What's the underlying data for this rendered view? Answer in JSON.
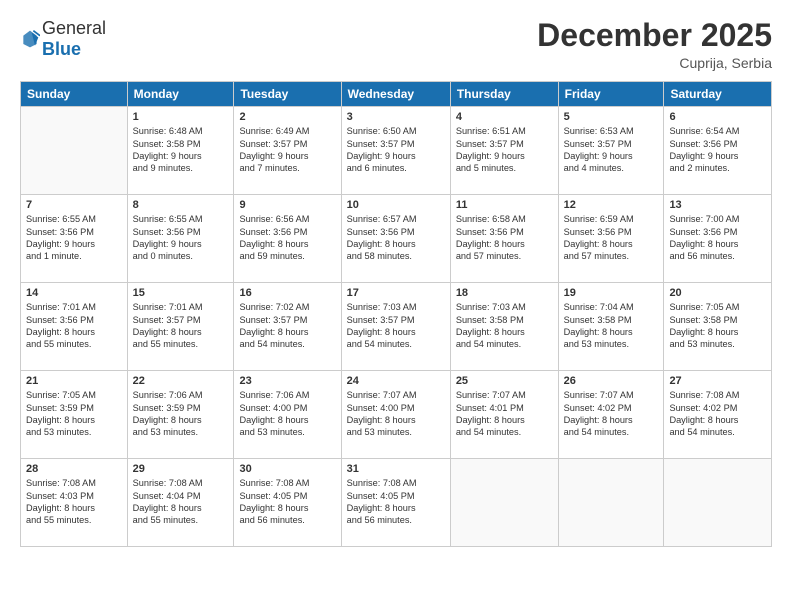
{
  "header": {
    "logo_general": "General",
    "logo_blue": "Blue",
    "month_year": "December 2025",
    "location": "Cuprija, Serbia"
  },
  "days_of_week": [
    "Sunday",
    "Monday",
    "Tuesday",
    "Wednesday",
    "Thursday",
    "Friday",
    "Saturday"
  ],
  "weeks": [
    [
      {
        "day": "",
        "info": ""
      },
      {
        "day": "1",
        "info": "Sunrise: 6:48 AM\nSunset: 3:58 PM\nDaylight: 9 hours\nand 9 minutes."
      },
      {
        "day": "2",
        "info": "Sunrise: 6:49 AM\nSunset: 3:57 PM\nDaylight: 9 hours\nand 7 minutes."
      },
      {
        "day": "3",
        "info": "Sunrise: 6:50 AM\nSunset: 3:57 PM\nDaylight: 9 hours\nand 6 minutes."
      },
      {
        "day": "4",
        "info": "Sunrise: 6:51 AM\nSunset: 3:57 PM\nDaylight: 9 hours\nand 5 minutes."
      },
      {
        "day": "5",
        "info": "Sunrise: 6:53 AM\nSunset: 3:57 PM\nDaylight: 9 hours\nand 4 minutes."
      },
      {
        "day": "6",
        "info": "Sunrise: 6:54 AM\nSunset: 3:56 PM\nDaylight: 9 hours\nand 2 minutes."
      }
    ],
    [
      {
        "day": "7",
        "info": "Sunrise: 6:55 AM\nSunset: 3:56 PM\nDaylight: 9 hours\nand 1 minute."
      },
      {
        "day": "8",
        "info": "Sunrise: 6:55 AM\nSunset: 3:56 PM\nDaylight: 9 hours\nand 0 minutes."
      },
      {
        "day": "9",
        "info": "Sunrise: 6:56 AM\nSunset: 3:56 PM\nDaylight: 8 hours\nand 59 minutes."
      },
      {
        "day": "10",
        "info": "Sunrise: 6:57 AM\nSunset: 3:56 PM\nDaylight: 8 hours\nand 58 minutes."
      },
      {
        "day": "11",
        "info": "Sunrise: 6:58 AM\nSunset: 3:56 PM\nDaylight: 8 hours\nand 57 minutes."
      },
      {
        "day": "12",
        "info": "Sunrise: 6:59 AM\nSunset: 3:56 PM\nDaylight: 8 hours\nand 57 minutes."
      },
      {
        "day": "13",
        "info": "Sunrise: 7:00 AM\nSunset: 3:56 PM\nDaylight: 8 hours\nand 56 minutes."
      }
    ],
    [
      {
        "day": "14",
        "info": "Sunrise: 7:01 AM\nSunset: 3:56 PM\nDaylight: 8 hours\nand 55 minutes."
      },
      {
        "day": "15",
        "info": "Sunrise: 7:01 AM\nSunset: 3:57 PM\nDaylight: 8 hours\nand 55 minutes."
      },
      {
        "day": "16",
        "info": "Sunrise: 7:02 AM\nSunset: 3:57 PM\nDaylight: 8 hours\nand 54 minutes."
      },
      {
        "day": "17",
        "info": "Sunrise: 7:03 AM\nSunset: 3:57 PM\nDaylight: 8 hours\nand 54 minutes."
      },
      {
        "day": "18",
        "info": "Sunrise: 7:03 AM\nSunset: 3:58 PM\nDaylight: 8 hours\nand 54 minutes."
      },
      {
        "day": "19",
        "info": "Sunrise: 7:04 AM\nSunset: 3:58 PM\nDaylight: 8 hours\nand 53 minutes."
      },
      {
        "day": "20",
        "info": "Sunrise: 7:05 AM\nSunset: 3:58 PM\nDaylight: 8 hours\nand 53 minutes."
      }
    ],
    [
      {
        "day": "21",
        "info": "Sunrise: 7:05 AM\nSunset: 3:59 PM\nDaylight: 8 hours\nand 53 minutes."
      },
      {
        "day": "22",
        "info": "Sunrise: 7:06 AM\nSunset: 3:59 PM\nDaylight: 8 hours\nand 53 minutes."
      },
      {
        "day": "23",
        "info": "Sunrise: 7:06 AM\nSunset: 4:00 PM\nDaylight: 8 hours\nand 53 minutes."
      },
      {
        "day": "24",
        "info": "Sunrise: 7:07 AM\nSunset: 4:00 PM\nDaylight: 8 hours\nand 53 minutes."
      },
      {
        "day": "25",
        "info": "Sunrise: 7:07 AM\nSunset: 4:01 PM\nDaylight: 8 hours\nand 54 minutes."
      },
      {
        "day": "26",
        "info": "Sunrise: 7:07 AM\nSunset: 4:02 PM\nDaylight: 8 hours\nand 54 minutes."
      },
      {
        "day": "27",
        "info": "Sunrise: 7:08 AM\nSunset: 4:02 PM\nDaylight: 8 hours\nand 54 minutes."
      }
    ],
    [
      {
        "day": "28",
        "info": "Sunrise: 7:08 AM\nSunset: 4:03 PM\nDaylight: 8 hours\nand 55 minutes."
      },
      {
        "day": "29",
        "info": "Sunrise: 7:08 AM\nSunset: 4:04 PM\nDaylight: 8 hours\nand 55 minutes."
      },
      {
        "day": "30",
        "info": "Sunrise: 7:08 AM\nSunset: 4:05 PM\nDaylight: 8 hours\nand 56 minutes."
      },
      {
        "day": "31",
        "info": "Sunrise: 7:08 AM\nSunset: 4:05 PM\nDaylight: 8 hours\nand 56 minutes."
      },
      {
        "day": "",
        "info": ""
      },
      {
        "day": "",
        "info": ""
      },
      {
        "day": "",
        "info": ""
      }
    ]
  ]
}
